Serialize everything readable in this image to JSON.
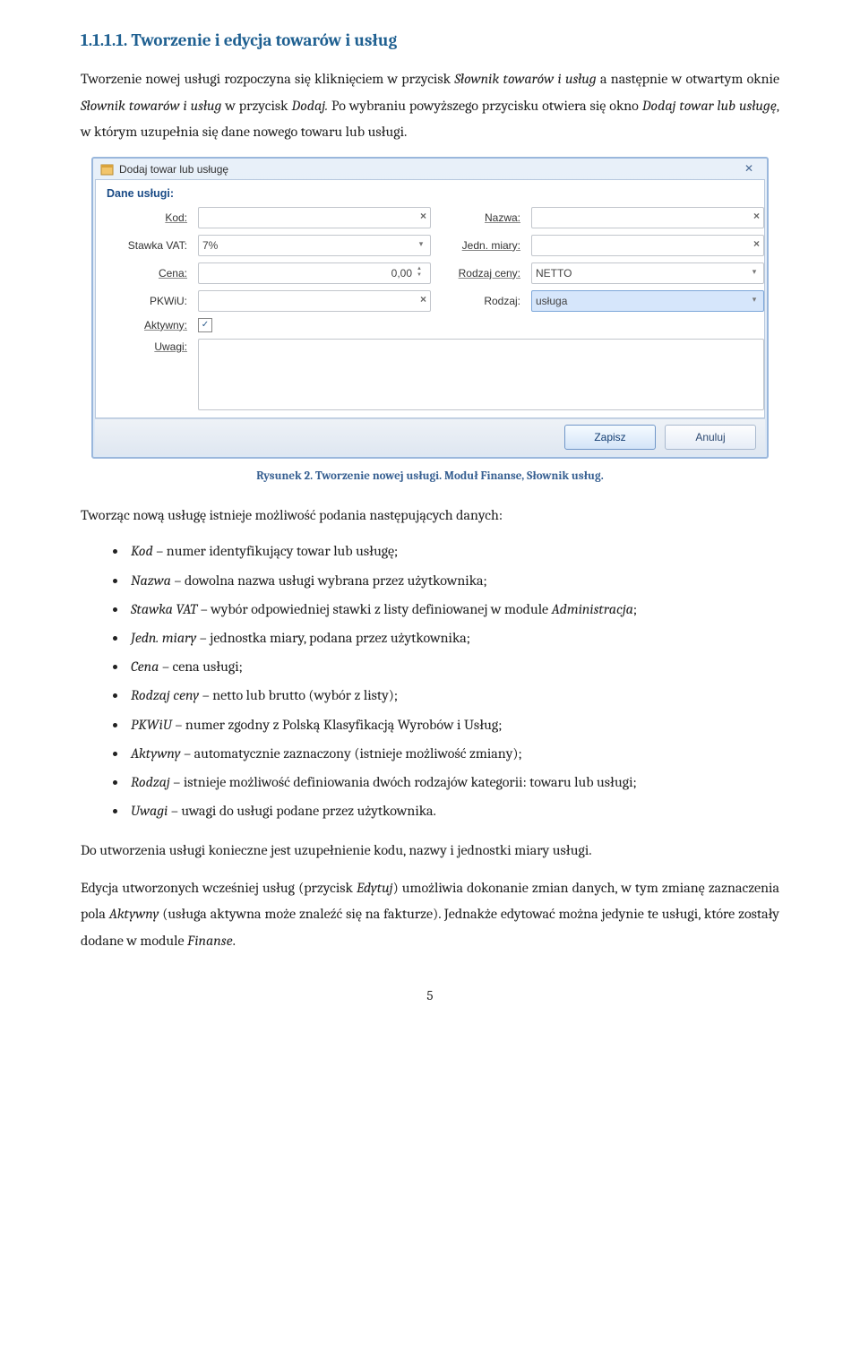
{
  "heading": "1.1.1.1.  Tworzenie i edycja towarów i usług",
  "para1_before_italic1": "Tworzenie nowej usługi rozpoczyna się kliknięciem w przycisk ",
  "para1_italic1": "Słownik towarów i usług",
  "para1_mid1": " a następnie w otwartym oknie ",
  "para1_italic2": "Słownik towarów i usług",
  "para1_mid2": " w przycisk ",
  "para1_italic3": "Dodaj.",
  "para1_mid3": " Po wybraniu powyższego przycisku otwiera się okno ",
  "para1_italic4": "Dodaj towar lub usługę",
  "para1_after": ", w którym uzupełnia się dane nowego towaru lub  usługi.",
  "caption": "Rysunek 2. Tworzenie nowej usługi. Moduł Finanse, Słownik usług.",
  "intro_list": "Tworząc nową usługę istnieje możliwość podania następujących danych:",
  "bullets": [
    {
      "term": "Kod",
      "desc": " – numer identyfikujący towar lub usługę;"
    },
    {
      "term": "Nazwa",
      "desc": " – dowolna nazwa usługi wybrana przez użytkownika;"
    },
    {
      "term": "Stawka VAT",
      "desc": " – wybór odpowiedniej stawki z listy definiowanej w module ",
      "tail_italic": "Administracja",
      "tail_after": ";"
    },
    {
      "term": "Jedn. miary",
      "desc": " – jednostka miary, podana przez użytkownika;"
    },
    {
      "term": "Cena",
      "desc": " – cena usługi;"
    },
    {
      "term": "Rodzaj ceny",
      "desc": " – netto lub brutto (wybór z listy);"
    },
    {
      "term": "PKWiU",
      "desc": " – numer zgodny z Polską Klasyfikacją Wyrobów i Usług;"
    },
    {
      "term": "Aktywny",
      "desc": " – automatycznie zaznaczony (istnieje możliwość zmiany);"
    },
    {
      "term": "Rodzaj",
      "desc": " – istnieje możliwość definiowania  dwóch rodzajów kategorii: towaru lub usługi;"
    },
    {
      "term": "Uwagi",
      "desc": " – uwagi do usługi podane przez użytkownika."
    }
  ],
  "para_end1": "Do utworzenia usługi konieczne jest uzupełnienie kodu, nazwy i jednostki miary usługi.",
  "para_end2_a": "Edycja utworzonych wcześniej usług (przycisk ",
  "para_end2_i": "Edytuj",
  "para_end2_b": ") umożliwia dokonanie zmian danych, w tym zmianę zaznaczenia pola ",
  "para_end2_i2": "Aktywny",
  "para_end2_c": " (usługa aktywna może znaleźć się na fakturze). Jednakże  edytować można jedynie te  usługi, które zostały dodane w  module ",
  "para_end2_i3": "Finanse",
  "para_end2_d": ".",
  "page_number": "5",
  "dialog": {
    "title": "Dodaj towar lub usługę",
    "section": "Dane usługi:",
    "labels": {
      "kod": "Kod:",
      "nazwa": "Nazwa:",
      "stawka": "Stawka VAT:",
      "jedn": "Jedn. miary:",
      "cena": "Cena:",
      "rodzaj_ceny": "Rodzaj ceny:",
      "pkwiu": "PKWiU:",
      "rodzaj": "Rodzaj:",
      "aktywny": "Aktywny:",
      "uwagi": "Uwagi:"
    },
    "values": {
      "stawka": "7%",
      "cena": "0,00",
      "rodzaj_ceny": "NETTO",
      "rodzaj": "usługa",
      "aktywny_checked": "✓"
    },
    "buttons": {
      "save": "Zapisz",
      "cancel": "Anuluj"
    }
  }
}
